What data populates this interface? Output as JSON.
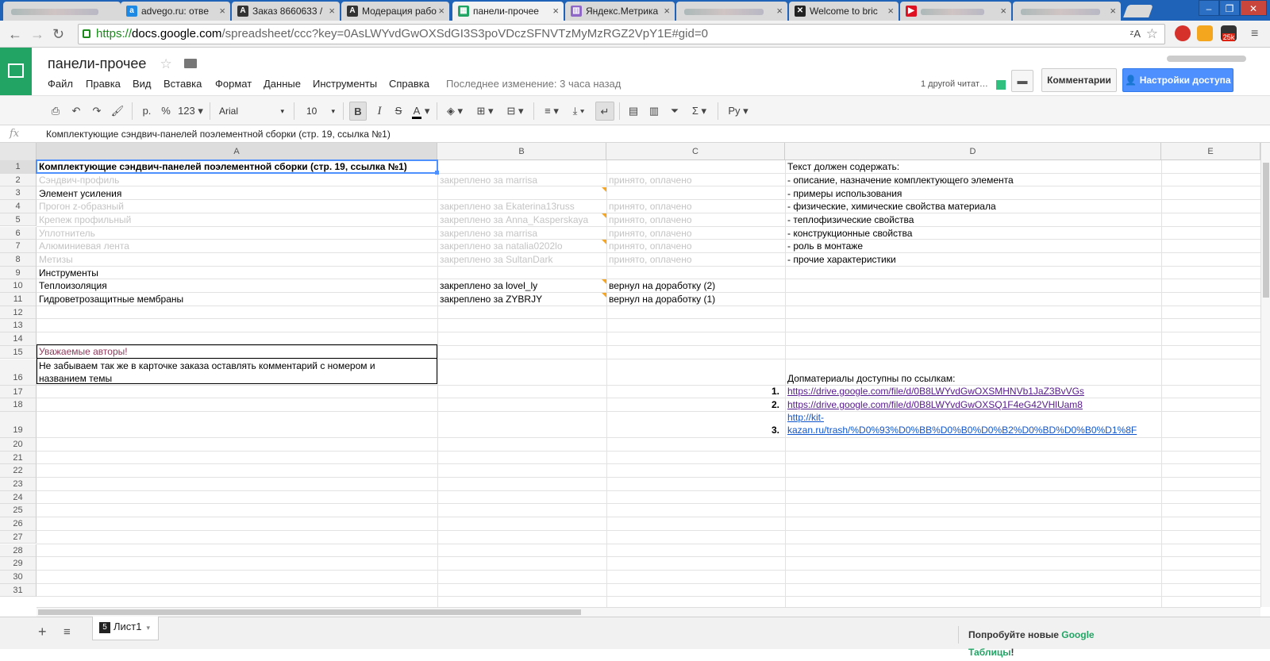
{
  "browser": {
    "tabs": [
      {
        "label": "",
        "blurred": true
      },
      {
        "label": "advego.ru: отвe"
      },
      {
        "label": "Заказ 8660633 / "
      },
      {
        "label": "Модерация рабо"
      },
      {
        "label": "панели-прочее",
        "active": true
      },
      {
        "label": "Яндекс.Метрика"
      },
      {
        "label": "",
        "blurred": true
      },
      {
        "label": "Welcome to bric"
      },
      {
        "label": "",
        "blurred": true
      },
      {
        "label": "",
        "blurred": true
      }
    ],
    "url": {
      "scheme": "https://",
      "domain": "docs.google.com",
      "path": "/spreadsheet/ccc?key=0AsLWYvdGwOXSdGI3S3poVDczSFNVTzMyMzRGZ2VpY1E#gid=0"
    },
    "badge": "25k"
  },
  "app": {
    "title": "панели-прочее",
    "menu": [
      "Файл",
      "Правка",
      "Вид",
      "Вставка",
      "Формат",
      "Данные",
      "Инструменты",
      "Справка"
    ],
    "last_edit": "Последнее изменение: 3 часа назад",
    "readers": "1 другой читат…",
    "comments_label": "Комментарии",
    "share_label": "Настройки доступа"
  },
  "toolbar": {
    "currency": "р.",
    "percent": "%",
    "number_format": "123",
    "font": "Arial",
    "size": "10",
    "input_lang": "Ру"
  },
  "formula_bar": {
    "fx": "fx",
    "value": "Комплектующие сэндвич-панелей поэлементной сборки (стр. 19, ссылка №1)"
  },
  "sheet": {
    "columns": [
      "A",
      "B",
      "C",
      "D",
      "E"
    ],
    "rows": [
      "1",
      "2",
      "3",
      "4",
      "5",
      "6",
      "7",
      "8",
      "9",
      "10",
      "11",
      "12",
      "13",
      "14",
      "15",
      "16",
      "17",
      "18",
      "19",
      "20",
      "21",
      "22",
      "23",
      "24",
      "25",
      "26",
      "27",
      "28",
      "29",
      "30",
      "31"
    ],
    "cells": {
      "A1": "Комплектующие сэндвич-панелей поэлементной сборки (стр. 19, ссылка №1)",
      "A2": "Сэндвич-профиль",
      "B2": "закреплено за marrisa",
      "C2": "принято, оплачено",
      "A3": "Элемент усиления",
      "A4": "Прогон z-образный",
      "B4": "закреплено за Ekaterina13russ",
      "C4": "принято, оплачено",
      "A5": "Крепеж профильный",
      "B5": "закреплено за Anna_Kasperskaya",
      "C5": "принято, оплачено",
      "A6": "Уплотнитель",
      "B6": "закреплено за marrisa",
      "C6": "принято, оплачено",
      "A7": "Алюминиевая лента",
      "B7": "закреплено за natalia0202lo",
      "C7": "принято, оплачено",
      "A8": "Метизы",
      "B8": "закреплено за SultanDark",
      "C8": "принято, оплачено",
      "A9": "Инструменты",
      "A10": "Теплоизоляция",
      "B10": "закреплено за lovel_ly",
      "C10": "вернул на доработку (2)",
      "A11": "Гидроветрозащитные мембраны",
      "B11": "закреплено за ZYBRJY",
      "C11": "вернул на доработку (1)",
      "A15": "Уважаемые авторы!",
      "A16a": "Не забываем так же в карточке заказа оставлять комментарий с номером и",
      "A16b": "названием темы",
      "D1": "Текст должен содержать:",
      "D2": "- описание, назначение комплектующего элемента",
      "D3": "- примеры использования",
      "D4": "- физические, химические свойства материала",
      "D5": "- теплофизические свойства",
      "D6": "- конструкционные свойства",
      "D7": "- роль в монтаже",
      "D8": "- прочие характеристики",
      "D16": "Допматериалы доступны по ссылкам:",
      "C17": "1.",
      "D17": "https://drive.google.com/file/d/0B8LWYvdGwOXSMHNVb1JaZ3BvVGs",
      "C18": "2.",
      "D18": "https://drive.google.com/file/d/0B8LWYvdGwOXSQ1F4eG42VHlUam8",
      "C19": "3.",
      "D19a": "http://kit-",
      "D19b": "kazan.ru/trash/%D0%93%D0%BB%D0%B0%D0%B2%D0%BD%D0%B0%D1%8F"
    }
  },
  "bottom": {
    "sheet_num": "5",
    "sheet_name": "Лист1",
    "add": "+",
    "try_prefix": "Попробуйте новые ",
    "try_brand": "Google Таблицы",
    "try_suffix": "!"
  }
}
